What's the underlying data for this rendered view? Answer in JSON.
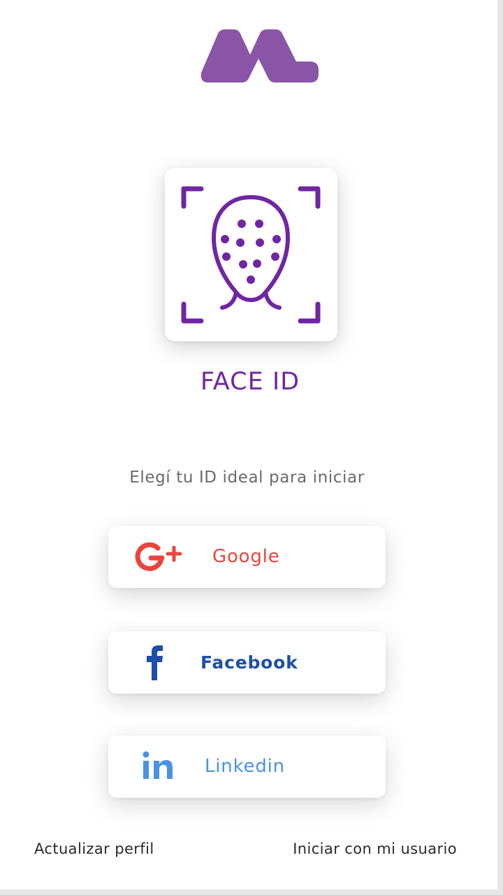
{
  "face": {
    "title": "FACE ID"
  },
  "subtitle": "Elegí tu ID ideal para iniciar",
  "buttons": {
    "google": "Google",
    "facebook": "Facebook",
    "linkedin": "Linkedin"
  },
  "footer": {
    "update_profile": "Actualizar perfil",
    "login_user": "Iniciar con mi usuario"
  },
  "icons": {
    "logo": "brand-logo-icon",
    "face": "face-id-icon",
    "google": "google-plus-icon",
    "facebook": "facebook-icon",
    "linkedin": "linkedin-icon"
  },
  "colors": {
    "primary_purple": "#7026a4",
    "logo_purple": "#8a55a6",
    "google_red": "#e8453c",
    "facebook_blue": "#1c4fa8",
    "linkedin_blue": "#4a92e3"
  }
}
